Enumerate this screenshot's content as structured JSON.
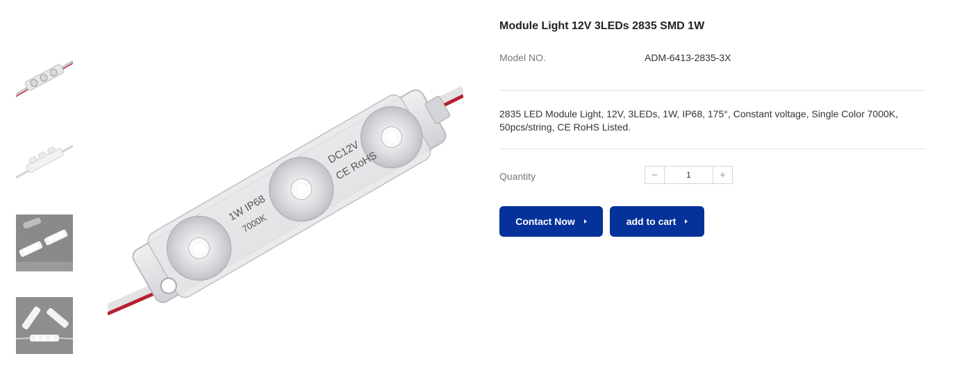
{
  "product": {
    "title": "Module Light 12V 3LEDs 2835 SMD 1W",
    "model_label": "Model NO.",
    "model_value": "ADM-6413-2835-3X",
    "description": "2835 LED Module Light, 12V, 3LEDs, 1W, IP68, 175°, Constant voltage, Single Color 7000K, 50pcs/string, CE RoHS Listed.",
    "quantity_label": "Quantity",
    "quantity_value": "1",
    "minus_icon": "−",
    "plus_icon": "+"
  },
  "image_text": {
    "spec_line1": "1W IP68",
    "spec_line2": "7000K",
    "volt_line1": "DC12V",
    "volt_line2": "CE RoHS"
  },
  "actions": {
    "contact_label": "Contact Now",
    "cart_label": "add to cart"
  },
  "colors": {
    "button_bg": "#04319a",
    "button_text": "#ffffff"
  }
}
